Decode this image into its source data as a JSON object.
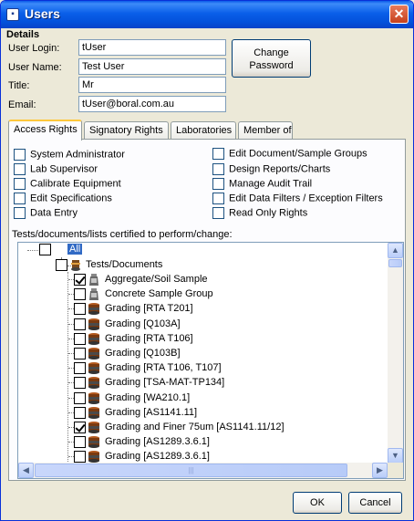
{
  "window": {
    "title": "Users",
    "close_glyph": "✕",
    "icon": "app-icon"
  },
  "details": {
    "heading": "Details",
    "login_label": "User Login:",
    "login_value": "tUser",
    "name_label": "User Name:",
    "name_value": "Test User",
    "title_label": "Title:",
    "title_value": "Mr",
    "email_label": "Email:",
    "email_value": "tUser@boral.com.au",
    "change_password_line1": "Change",
    "change_password_line2": "Password"
  },
  "tabs": [
    {
      "label": "Access Rights",
      "active": true
    },
    {
      "label": "Signatory Rights",
      "active": false
    },
    {
      "label": "Laboratories",
      "active": false
    },
    {
      "label": "Member of",
      "active": false
    }
  ],
  "access_rights": {
    "left": [
      {
        "label": "System Administrator",
        "checked": false
      },
      {
        "label": "Lab Supervisor",
        "checked": false
      },
      {
        "label": "Calibrate Equipment",
        "checked": false
      },
      {
        "label": "Edit Specifications",
        "checked": false
      },
      {
        "label": "Data Entry",
        "checked": false
      }
    ],
    "right": [
      {
        "label": "Edit Document/Sample Groups",
        "checked": false
      },
      {
        "label": "Design Reports/Charts",
        "checked": false
      },
      {
        "label": "Manage Audit Trail",
        "checked": false
      },
      {
        "label": "Edit Data Filters / Exception Filters",
        "checked": false
      },
      {
        "label": "Read Only Rights",
        "checked": false
      }
    ],
    "tree_caption": "Tests/documents/lists certified to perform/change:"
  },
  "tree": {
    "root": {
      "label": "All",
      "checked": false
    },
    "group": {
      "label": "Tests/Documents",
      "checked": false
    },
    "items": [
      {
        "label": "Aggregate/Soil Sample",
        "checked": true,
        "icon": "sample-jar-icon"
      },
      {
        "label": "Concrete Sample Group",
        "checked": false,
        "icon": "sample-jar-icon"
      },
      {
        "label": "Grading [RTA T201]",
        "checked": false,
        "icon": "sieve-stack-icon"
      },
      {
        "label": "Grading [Q103A]",
        "checked": false,
        "icon": "sieve-stack-icon"
      },
      {
        "label": "Grading [RTA T106]",
        "checked": false,
        "icon": "sieve-stack-icon"
      },
      {
        "label": "Grading [Q103B]",
        "checked": false,
        "icon": "sieve-stack-icon"
      },
      {
        "label": "Grading [RTA T106, T107]",
        "checked": false,
        "icon": "sieve-stack-icon"
      },
      {
        "label": "Grading [TSA-MAT-TP134]",
        "checked": false,
        "icon": "sieve-stack-icon"
      },
      {
        "label": "Grading [WA210.1]",
        "checked": false,
        "icon": "sieve-stack-icon"
      },
      {
        "label": "Grading [AS1141.11]",
        "checked": false,
        "icon": "sieve-stack-icon"
      },
      {
        "label": "Grading and Finer 75um [AS1141.11/12]",
        "checked": true,
        "icon": "sieve-stack-icon"
      },
      {
        "label": "Grading [AS1289.3.6.1]",
        "checked": false,
        "icon": "sieve-stack-icon"
      },
      {
        "label": "Grading [AS1289.3.6.1]",
        "checked": false,
        "icon": "sieve-stack-icon"
      }
    ]
  },
  "scroll": {
    "up": "▲",
    "down": "▼",
    "left": "◀",
    "right": "▶",
    "grip": "|||"
  },
  "buttons": {
    "ok": "OK",
    "cancel": "Cancel"
  }
}
